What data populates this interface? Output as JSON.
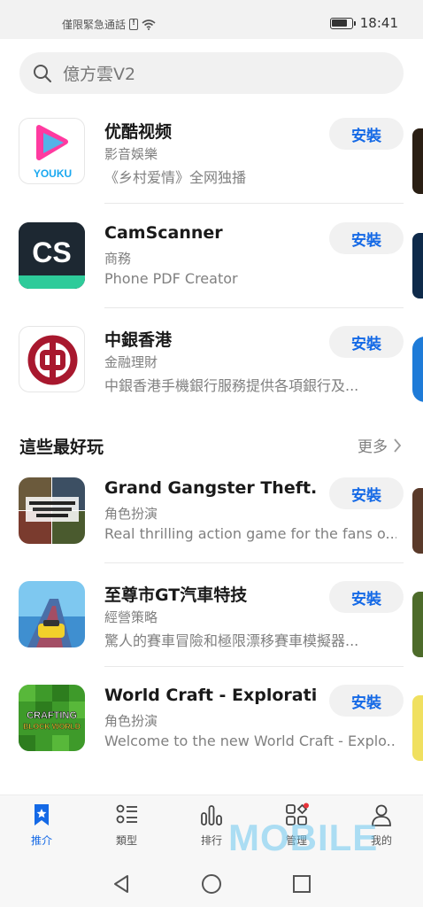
{
  "status_bar": {
    "carrier_text": "僅限緊急通話",
    "sim_glyph": "!",
    "time": "18:41",
    "battery_level": 0.85
  },
  "search": {
    "placeholder": "億方雲V2"
  },
  "featured_apps": [
    {
      "name": "优酷视频",
      "category": "影音娛樂",
      "description": "《乡村爱情》全网独播",
      "install_label": "安裝",
      "icon": "youku-logo-icon",
      "icon_text": "YOUKU"
    },
    {
      "name": "CamScanner",
      "category": "商務",
      "description": "Phone PDF Creator",
      "install_label": "安裝",
      "icon": "camscanner-logo-icon",
      "icon_text": "CS"
    },
    {
      "name": "中銀香港",
      "category": "金融理財",
      "description": "中銀香港手機銀行服務提供各項銀行及...",
      "install_label": "安裝",
      "icon": "boc-logo-icon"
    }
  ],
  "section": {
    "title": "這些最好玩",
    "more_label": "更多"
  },
  "game_apps": [
    {
      "name": "Grand Gangster Theft...",
      "category": "角色扮演",
      "description": "Real thrilling action game for the fans o...",
      "install_label": "安裝",
      "icon": "gangster-game-icon"
    },
    {
      "name": "至尊市GT汽車特技",
      "category": "經營策略",
      "description": "驚人的賽車冒險和極限漂移賽車模擬器...",
      "install_label": "安裝",
      "icon": "racing-game-icon"
    },
    {
      "name": "World Craft - Explorati...",
      "category": "角色扮演",
      "description": "Welcome to the new World Craft - Explo...",
      "install_label": "安裝",
      "icon": "craft-game-icon",
      "icon_text_1": "CRAFTING",
      "icon_text_2": "BLOCK WORLD"
    }
  ],
  "bottom_nav": [
    {
      "label": "推介",
      "icon": "star-bookmark-icon",
      "active": true
    },
    {
      "label": "類型",
      "icon": "category-list-icon",
      "active": false
    },
    {
      "label": "排行",
      "icon": "ranking-bars-icon",
      "active": false
    },
    {
      "label": "管理",
      "icon": "manage-grid-icon",
      "active": false
    },
    {
      "label": "我的",
      "icon": "profile-icon",
      "active": false
    }
  ],
  "watermark": "MOBILE",
  "colors": {
    "accent": "#1469e6",
    "text_secondary": "#808080",
    "button_bg": "#f1f1f1"
  }
}
